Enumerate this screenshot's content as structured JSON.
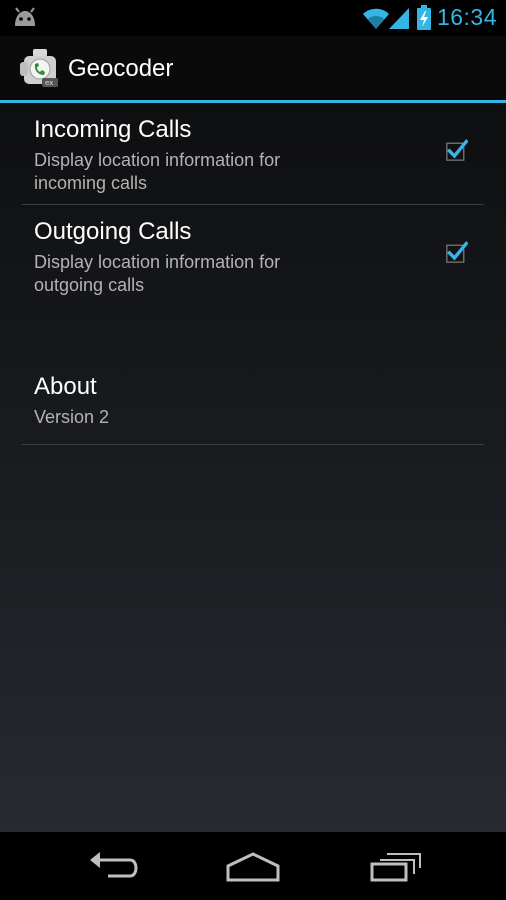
{
  "status_bar": {
    "time": "16:34",
    "icons": [
      "android-icon",
      "wifi-icon",
      "signal-icon",
      "battery-charging-icon"
    ],
    "accent_color": "#33b5e5"
  },
  "action_bar": {
    "title": "Geocoder",
    "icon": "geocoder-app-icon"
  },
  "preferences": [
    {
      "title": "Incoming Calls",
      "summary": "Display location information for incoming calls",
      "checked": true
    },
    {
      "title": "Outgoing Calls",
      "summary": "Display location information for outgoing calls",
      "checked": true
    },
    {
      "title": "About",
      "summary": "Version 2"
    }
  ],
  "nav_bar": {
    "buttons": [
      "back-icon",
      "home-icon",
      "recent-apps-icon"
    ]
  }
}
